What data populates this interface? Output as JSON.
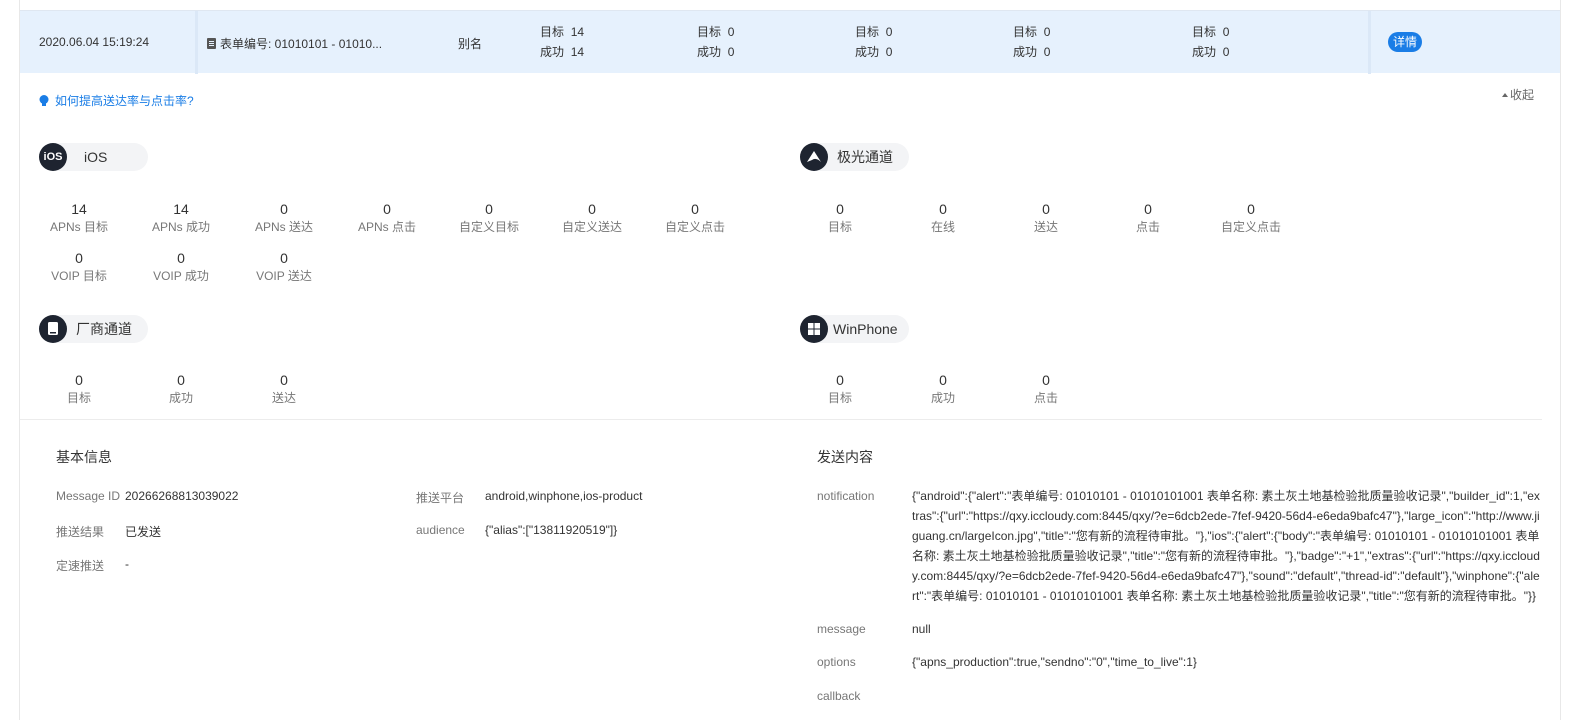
{
  "summary": {
    "datetime": "2020.06.04 15:19:24",
    "form_text": "表单编号: 01010101 - 01010...",
    "alias": "别名",
    "stats": [
      {
        "target_label": "目标",
        "target": "14",
        "success_label": "成功",
        "success": "14"
      },
      {
        "target_label": "目标",
        "target": "0",
        "success_label": "成功",
        "success": "0"
      },
      {
        "target_label": "目标",
        "target": "0",
        "success_label": "成功",
        "success": "0"
      },
      {
        "target_label": "目标",
        "target": "0",
        "success_label": "成功",
        "success": "0"
      },
      {
        "target_label": "目标",
        "target": "0",
        "success_label": "成功",
        "success": "0"
      }
    ],
    "detail_button": "详情"
  },
  "tip": "如何提高送达率与点击率?",
  "collapse": "收起",
  "channels": {
    "ios": {
      "badge": "iOS",
      "label": "iOS",
      "row1": [
        {
          "value": "14",
          "label": "APNs 目标"
        },
        {
          "value": "14",
          "label": "APNs 成功"
        },
        {
          "value": "0",
          "label": "APNs 送达"
        },
        {
          "value": "0",
          "label": "APNs 点击"
        },
        {
          "value": "0",
          "label": "自定义目标"
        },
        {
          "value": "0",
          "label": "自定义送达"
        },
        {
          "value": "0",
          "label": "自定义点击"
        }
      ],
      "row2": [
        {
          "value": "0",
          "label": "VOIP 目标"
        },
        {
          "value": "0",
          "label": "VOIP 成功"
        },
        {
          "value": "0",
          "label": "VOIP 送达"
        }
      ]
    },
    "jiguang": {
      "label": "极光通道",
      "stats": [
        {
          "value": "0",
          "label": "目标"
        },
        {
          "value": "0",
          "label": "在线"
        },
        {
          "value": "0",
          "label": "送达"
        },
        {
          "value": "0",
          "label": "点击"
        },
        {
          "value": "0",
          "label": "自定义点击"
        }
      ]
    },
    "vendor": {
      "label": "厂商通道",
      "stats": [
        {
          "value": "0",
          "label": "目标"
        },
        {
          "value": "0",
          "label": "成功"
        },
        {
          "value": "0",
          "label": "送达"
        }
      ]
    },
    "winphone": {
      "label": "WinPhone",
      "stats": [
        {
          "value": "0",
          "label": "目标"
        },
        {
          "value": "0",
          "label": "成功"
        },
        {
          "value": "0",
          "label": "点击"
        }
      ]
    }
  },
  "basic": {
    "title": "基本信息",
    "message_id_label": "Message ID",
    "message_id": "20266268813039022",
    "result_label": "推送结果",
    "result": "已发送",
    "speed_label": "定速推送",
    "speed": "-",
    "platform_label": "推送平台",
    "platform": "android,winphone,ios-product",
    "audience_label": "audience",
    "audience": "{\"alias\":[\"13811920519\"]}"
  },
  "content": {
    "title": "发送内容",
    "notification_label": "notification",
    "notification": "{\"android\":{\"alert\":\"表单编号: 01010101 - 01010101001 表单名称: 素土灰土地基检验批质量验收记录\",\"builder_id\":1,\"extras\":{\"url\":\"https://qxy.iccloudy.com:8445/qxy/?e=6dcb2ede-7fef-9420-56d4-e6eda9bafc47\"},\"large_icon\":\"http://www.jiguang.cn/largeIcon.jpg\",\"title\":\"您有新的流程待审批。\"},\"ios\":{\"alert\":{\"body\":\"表单编号: 01010101 - 01010101001 表单名称: 素土灰土地基检验批质量验收记录\",\"title\":\"您有新的流程待审批。\"},\"badge\":\"+1\",\"extras\":{\"url\":\"https://qxy.iccloudy.com:8445/qxy/?e=6dcb2ede-7fef-9420-56d4-e6eda9bafc47\"},\"sound\":\"default\",\"thread-id\":\"default\"},\"winphone\":{\"alert\":\"表单编号: 01010101 - 01010101001 表单名称: 素土灰土地基检验批质量验收记录\",\"title\":\"您有新的流程待审批。\"}}",
    "message_label": "message",
    "message": "null",
    "options_label": "options",
    "options": "{\"apns_production\":true,\"sendno\":\"0\",\"time_to_live\":1}",
    "callback_label": "callback"
  }
}
